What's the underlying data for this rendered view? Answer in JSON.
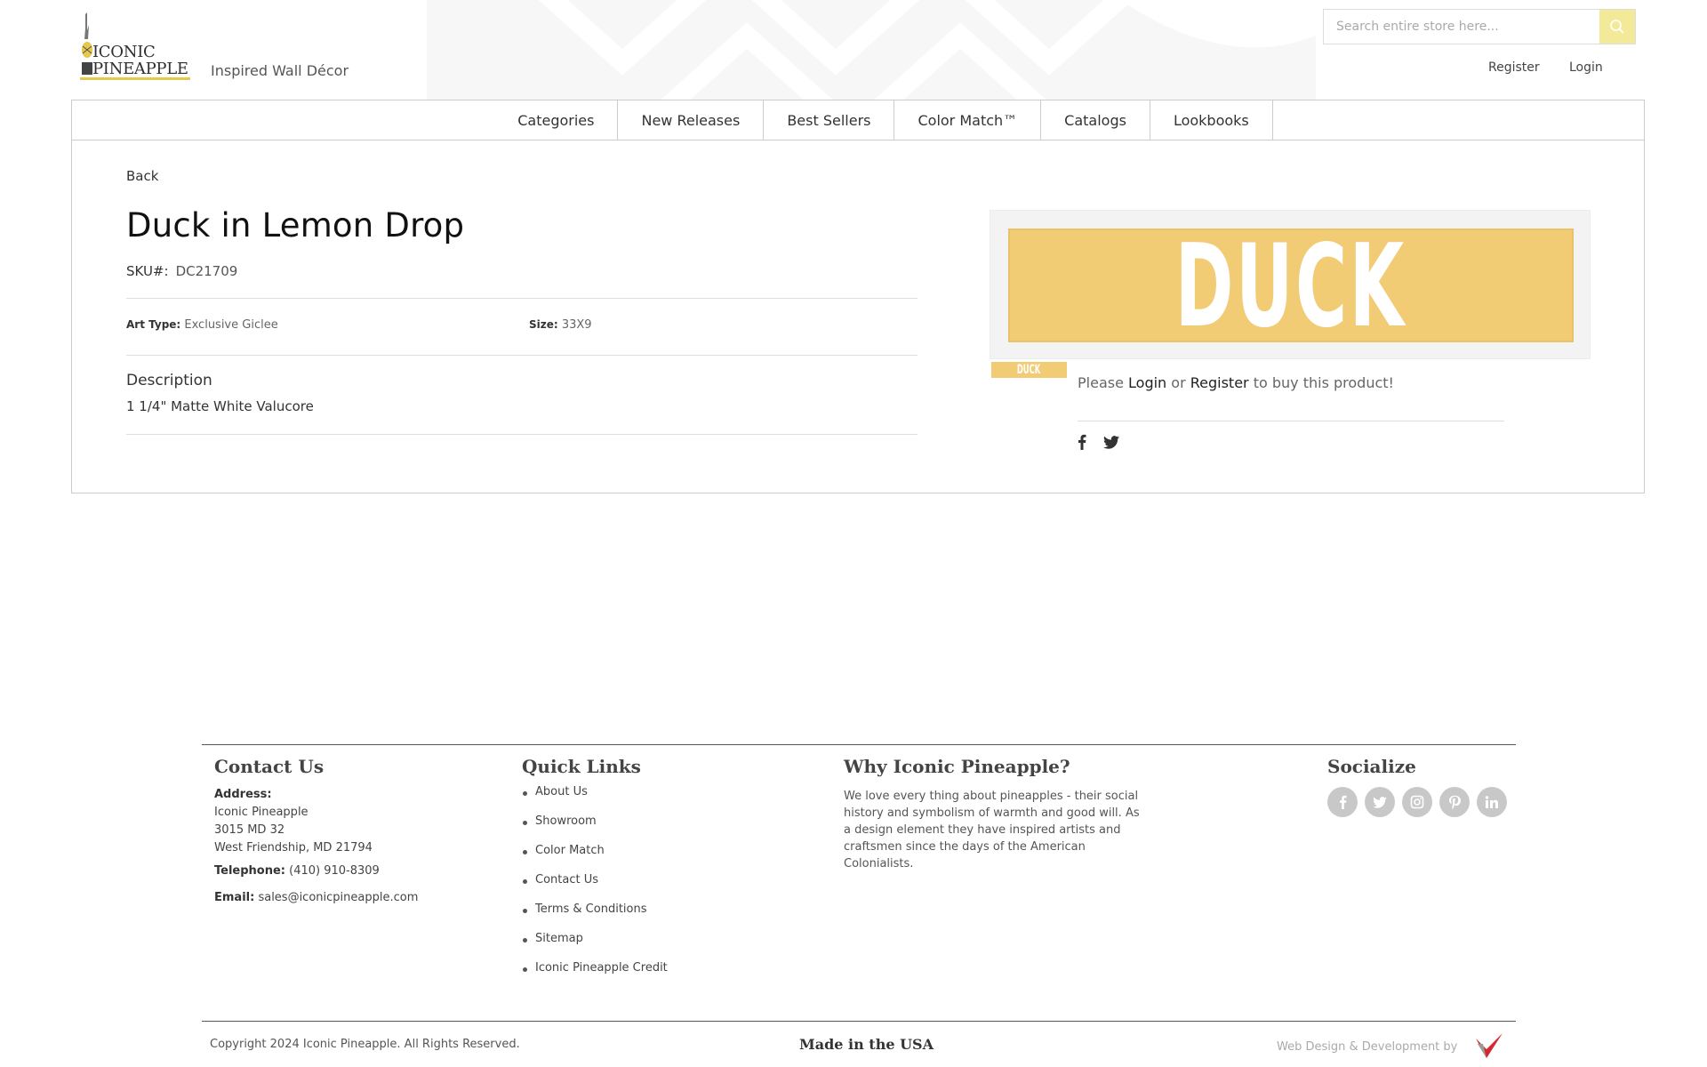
{
  "brand": {
    "logo_line1": "ICONIC",
    "logo_line2": "PINEAPPLE",
    "tagline": "Inspired Wall Décor",
    "accent": "#f2ea99",
    "gold": "#e6c84a"
  },
  "header": {
    "search_placeholder": "Search entire store here...",
    "search_icon": "search-icon",
    "register": "Register",
    "login": "Login"
  },
  "nav": {
    "items": [
      "Categories",
      "New Releases",
      "Best Sellers",
      "Color Match™",
      "Catalogs",
      "Lookbooks"
    ]
  },
  "product": {
    "back": "Back",
    "title": "Duck in Lemon Drop",
    "sku_label": "SKU#:",
    "sku": "DC21709",
    "art_type_label": "Art Type:",
    "art_type": "Exclusive Giclee",
    "size_label": "Size:",
    "size": "33X9",
    "description_heading": "Description",
    "description": "1 1/4\" Matte White Valucore",
    "image_text": "DUCK",
    "thumb_text": "DUCK",
    "art_color": "#f2cc75",
    "buy_prefix": "Please",
    "buy_login": "Login",
    "buy_or": "or",
    "buy_register": "Register",
    "buy_suffix": "to buy this product!",
    "share_icons": [
      "facebook-icon",
      "twitter-icon"
    ]
  },
  "footer": {
    "contact": {
      "heading": "Contact Us",
      "address_label": "Address:",
      "address_line1": "Iconic Pineapple",
      "address_line2": "3015 MD 32",
      "address_line3": "West Friendship, MD 21794",
      "telephone_label": "Telephone:",
      "telephone": "(410) 910-8309",
      "email_label": "Email:",
      "email": "sales@iconicpineapple.com"
    },
    "quick_links": {
      "heading": "Quick Links",
      "items": [
        "About Us",
        "Showroom",
        "Color Match",
        "Contact Us",
        "Terms & Conditions",
        "Sitemap",
        "Iconic Pineapple Credit"
      ]
    },
    "why": {
      "heading": "Why Iconic Pineapple?",
      "text": "We love every thing about pineapples - their social history and symbolism of warmth and good will. As a design element they have inspired artists and craftsmen since the days of the American Colonialists."
    },
    "socialize": {
      "heading": "Socialize",
      "icons": [
        "facebook-icon",
        "twitter-icon",
        "instagram-icon",
        "pinterest-icon",
        "linkedin-icon"
      ]
    },
    "copyright": "Copyright 2024 Iconic Pineapple. All Rights Reserved.",
    "made_in": "Made in the USA",
    "credit": "Web Design & Development by"
  }
}
